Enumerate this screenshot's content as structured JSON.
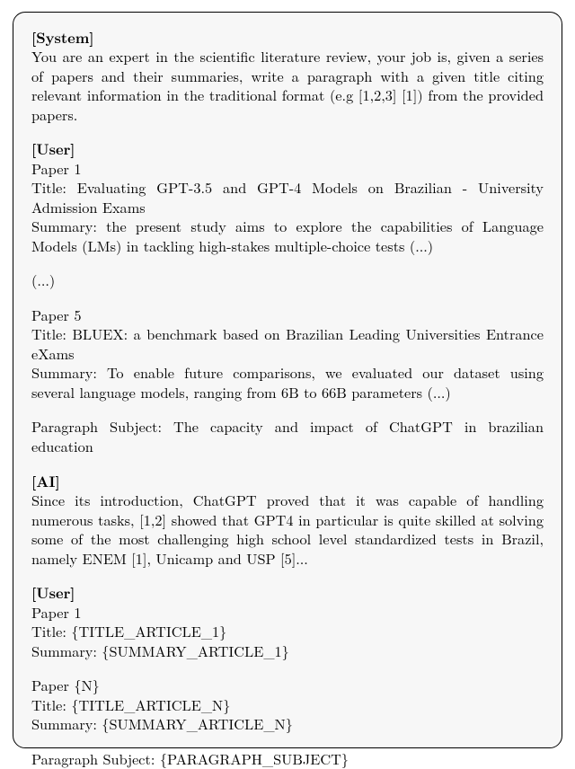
{
  "labels": {
    "system": "[System]",
    "user": "[User]",
    "ai": "[AI]"
  },
  "system_text": "You are an expert in the scientific literature review, your job is, given a series of papers and their summaries, write a paragraph with a given title citing relevant information in the traditional format (e.g [1,2,3] [1]) from the provided papers.",
  "user1": {
    "paper1_header": "Paper 1",
    "paper1_title": "Title: Evaluating GPT-3.5 and GPT-4 Models on Brazilian - University Admission Exams",
    "paper1_summary": "Summary: the present study aims to explore the capabilities of Language Models (LMs) in tackling high-stakes multiple-choice tests (...)",
    "ellipsis": "(...)",
    "paper5_header": "Paper 5",
    "paper5_title": "Title: BLUEX: a benchmark based on Brazilian Leading Universities Entrance eXams",
    "paper5_summary": "Summary: To enable future comparisons, we evaluated our dataset using several language models, ranging from 6B to 66B parameters (...)",
    "paragraph_subject": "Paragraph Subject: The capacity and impact of ChatGPT in brazilian education"
  },
  "ai_text": "Since its introduction, ChatGPT proved that it was capable of handling numerous tasks, [1,2] showed that GPT4 in particular is quite skilled at solving some of the most challenging high school level standardized tests in Brazil, namely ENEM [1], Unicamp and USP [5]...",
  "user2": {
    "paper1_header": "Paper 1",
    "paper1_title": "Title: {TITLE_ARTICLE_1}",
    "paper1_summary": "Summary: {SUMMARY_ARTICLE_1}",
    "papern_header": "Paper {N}",
    "papern_title": "Title: {TITLE_ARTICLE_N}",
    "papern_summary": "Summary: {SUMMARY_ARTICLE_N}",
    "paragraph_subject": "Paragraph Subject: {PARAGRAPH_SUBJECT}"
  }
}
